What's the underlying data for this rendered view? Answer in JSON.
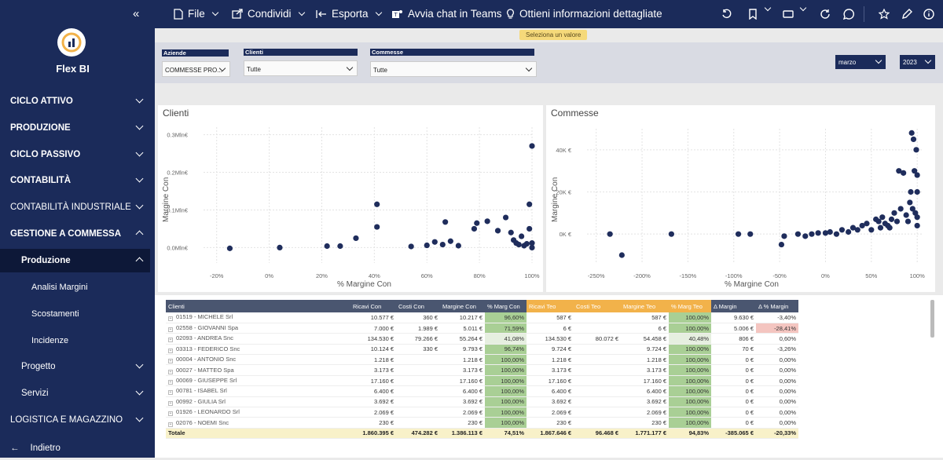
{
  "sidebar": {
    "brand": "Flex BI",
    "items": [
      {
        "label": "CICLO ATTIVO"
      },
      {
        "label": "PRODUZIONE"
      },
      {
        "label": "CICLO PASSIVO"
      },
      {
        "label": "CONTABILITÀ"
      },
      {
        "label": "CONTABILITÀ INDUSTRIALE"
      },
      {
        "label": "GESTIONE A COMMESSA"
      },
      {
        "label": "Produzione"
      },
      {
        "label": "Analisi Margini"
      },
      {
        "label": "Scostamenti"
      },
      {
        "label": "Incidenze"
      },
      {
        "label": "Progetto"
      },
      {
        "label": "Servizi"
      },
      {
        "label": "LOGISTICA E MAGAZZINO"
      },
      {
        "label": "Indietro"
      }
    ]
  },
  "toolbar": {
    "file": "File",
    "share": "Condividi",
    "export": "Esporta",
    "teams": "Avvia chat in Teams",
    "insights": "Ottieni informazioni dettagliate"
  },
  "tooltip": "Seleziona un valore",
  "filters": {
    "aziende": {
      "label": "Aziende",
      "value": "COMMESSE PRO..."
    },
    "clienti": {
      "label": "Clienti",
      "value": "Tutte"
    },
    "commesse": {
      "label": "Commesse",
      "value": "Tutte"
    },
    "month": "marzo",
    "year": "2023"
  },
  "charts": {
    "clienti": {
      "title": "Clienti",
      "ylabel": "Margine Con",
      "xlabel": "% Margine Con"
    },
    "commesse": {
      "title": "Commesse",
      "ylabel": "Margine Con",
      "xlabel": "% Margine Con"
    }
  },
  "chart_data": [
    {
      "type": "scatter",
      "title": "Clienti",
      "xlabel": "% Margine Con",
      "ylabel": "Margine Con",
      "xlim": [
        -25,
        100
      ],
      "ylim": [
        -0.02,
        0.32
      ],
      "x_ticks": [
        "-20%",
        "0%",
        "20%",
        "40%",
        "60%",
        "80%",
        "100%"
      ],
      "y_ticks": [
        "0.0Mln€",
        "0.1Mln€",
        "0.2Mln€",
        "0.3Mln€"
      ],
      "grid": true,
      "x": [
        -15,
        4,
        22,
        27,
        33,
        41,
        41,
        54,
        60,
        63,
        66,
        67,
        69,
        72,
        78,
        79,
        83,
        87,
        90,
        92,
        93,
        94,
        95,
        96,
        97,
        98,
        99,
        99,
        100,
        100,
        100
      ],
      "y": [
        -0.002,
        0.0,
        0.004,
        0.004,
        0.025,
        0.055,
        0.115,
        0.003,
        0.006,
        0.015,
        0.008,
        0.068,
        0.017,
        0.005,
        0.05,
        0.065,
        0.07,
        0.045,
        0.08,
        0.04,
        0.02,
        0.012,
        0.008,
        0.03,
        0.005,
        0.01,
        0.115,
        0.05,
        0.27,
        0.0,
        0.012
      ]
    },
    {
      "type": "scatter",
      "title": "Commesse",
      "xlabel": "% Margine Con",
      "ylabel": "Margine Con",
      "xlim": [
        -260,
        105
      ],
      "ylim": [
        -10000,
        50000
      ],
      "x_ticks": [
        "-250%",
        "-200%",
        "-150%",
        "-100%",
        "-50%",
        "0%",
        "50%",
        "100%"
      ],
      "y_ticks": [
        "0K €",
        "20K €",
        "40K €"
      ],
      "grid": true,
      "x": [
        -235,
        -222,
        -168,
        -95,
        -82,
        -48,
        -45,
        -30,
        -22,
        -15,
        -8,
        0,
        5,
        12,
        18,
        25,
        30,
        35,
        40,
        45,
        50,
        55,
        58,
        60,
        62,
        65,
        68,
        70,
        72,
        75,
        78,
        80,
        82,
        85,
        88,
        90,
        92,
        93,
        94,
        95,
        96,
        97,
        98,
        99,
        100,
        100,
        100,
        100
      ],
      "y": [
        0,
        -10000,
        0,
        0,
        0,
        -5000,
        -1000,
        0,
        -1000,
        0,
        500,
        500,
        1000,
        0,
        2000,
        1000,
        3000,
        2000,
        4000,
        5000,
        2000,
        7000,
        6000,
        3000,
        8000,
        5000,
        4000,
        3000,
        7000,
        10000,
        6000,
        30000,
        12000,
        29000,
        9000,
        6000,
        15000,
        20000,
        48000,
        12000,
        45000,
        30000,
        10000,
        40000,
        28000,
        8000,
        20000,
        4000
      ]
    }
  ],
  "table": {
    "headers": [
      "Clienti",
      "Ricavi Con",
      "Costi Con",
      "Margine Con",
      "% Marg Con",
      "Ricavi Teo",
      "Costi Teo",
      "Margine Teo",
      "% Marg Teo",
      "Δ Margin",
      "Δ % Margin"
    ],
    "rows": [
      [
        "01519 - MICHELE Srl",
        "10.577 €",
        "360 €",
        "10.217 €",
        "96,60%",
        "587 €",
        "",
        "587 €",
        "100,00%",
        "9.630 €",
        "-3,40%"
      ],
      [
        "02558 - GIOVANNI Spa",
        "7.000 €",
        "1.989 €",
        "5.011 €",
        "71,59%",
        "6 €",
        "",
        "6 €",
        "100,00%",
        "5.006 €",
        "-28,41%"
      ],
      [
        "02093 - ANDREA Snc",
        "134.530 €",
        "79.266 €",
        "55.264 €",
        "41,08%",
        "134.530 €",
        "80.072 €",
        "54.458 €",
        "40,48%",
        "806 €",
        "0,60%"
      ],
      [
        "03313 - FEDERICO Snc",
        "10.124 €",
        "330 €",
        "9.793 €",
        "96,74%",
        "9.724 €",
        "",
        "9.724 €",
        "100,00%",
        "70 €",
        "-3,26%"
      ],
      [
        "00004 - ANTONIO Snc",
        "1.218 €",
        "",
        "1.218 €",
        "100,00%",
        "1.218 €",
        "",
        "1.218 €",
        "100,00%",
        "0 €",
        "0,00%"
      ],
      [
        "00027 - MATTEO Spa",
        "3.173 €",
        "",
        "3.173 €",
        "100,00%",
        "3.173 €",
        "",
        "3.173 €",
        "100,00%",
        "0 €",
        "0,00%"
      ],
      [
        "00069 - GIUSEPPE Srl",
        "17.160 €",
        "",
        "17.160 €",
        "100,00%",
        "17.160 €",
        "",
        "17.160 €",
        "100,00%",
        "0 €",
        "0,00%"
      ],
      [
        "00781 - ISABEL Srl",
        "6.400 €",
        "",
        "6.400 €",
        "100,00%",
        "6.400 €",
        "",
        "6.400 €",
        "100,00%",
        "0 €",
        "0,00%"
      ],
      [
        "00992 - GIULIA Srl",
        "3.692 €",
        "",
        "3.692 €",
        "100,00%",
        "3.692 €",
        "",
        "3.692 €",
        "100,00%",
        "0 €",
        "0,00%"
      ],
      [
        "01926 - LEONARDO Srl",
        "2.069 €",
        "",
        "2.069 €",
        "100,00%",
        "2.069 €",
        "",
        "2.069 €",
        "100,00%",
        "0 €",
        "0,00%"
      ],
      [
        "02076 - NOEMI Snc",
        "230 €",
        "",
        "230 €",
        "100,00%",
        "230 €",
        "",
        "230 €",
        "100,00%",
        "0 €",
        "0,00%"
      ]
    ],
    "total": [
      "Totale",
      "1.860.395 €",
      "474.282 €",
      "1.386.113 €",
      "74,51%",
      "1.867.646 €",
      "96.468 €",
      "1.771.177 €",
      "94,83%",
      "-385.065 €",
      "-20,33%"
    ]
  },
  "colors": {
    "navy": "#1b2b5a",
    "dot": "#1f2d5c",
    "green": "#a9cf95",
    "orange": "#f2b24a",
    "red": "#f4c5c0"
  }
}
